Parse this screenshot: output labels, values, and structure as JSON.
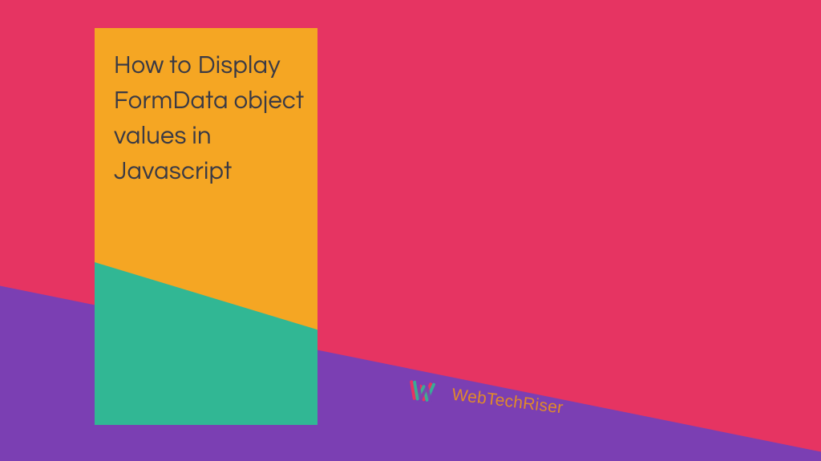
{
  "title": "How to Display FormData object values in Javascript",
  "brand": {
    "name": "WebTechRiser",
    "logo_name": "webtechriser-logo"
  },
  "colors": {
    "background": "#e63462",
    "purple": "#7b3fb3",
    "card_teal": "#31b794",
    "card_orange": "#f5a623",
    "title_text": "#3a3a45",
    "brand_text": "#e08a2a"
  }
}
